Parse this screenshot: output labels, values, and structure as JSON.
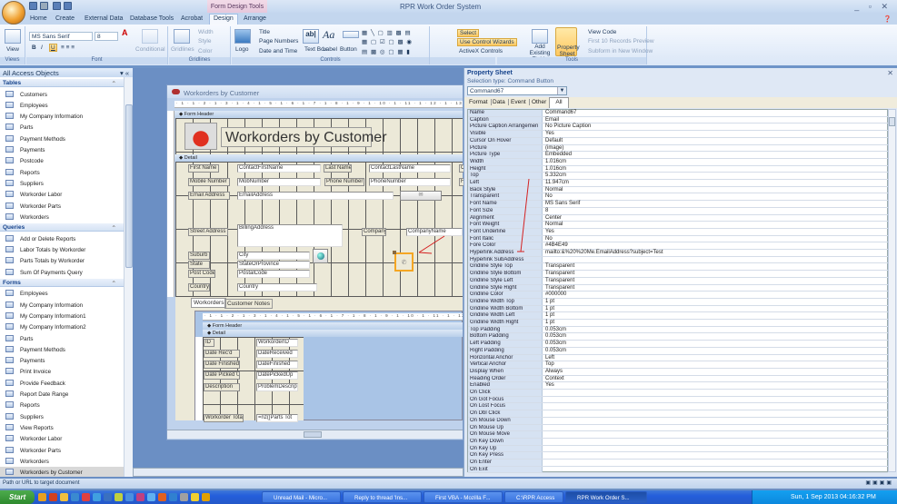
{
  "app_title": "RPR Work Order System",
  "context_title": "Form Design Tools",
  "window_controls": "_ ▫ ✕",
  "ribbon": {
    "tabs": [
      "Home",
      "Create",
      "External Data",
      "Database Tools",
      "Acrobat",
      "Design",
      "Arrange"
    ],
    "active_tab": "Design",
    "font_name": "MS Sans Serif",
    "font_size": "8",
    "buttons": {
      "view": "View",
      "conditional": "Conditional",
      "gridlines": "Gridlines",
      "width": "Width",
      "style": "Style",
      "color": "Color",
      "logo": "Logo",
      "title": "Title",
      "page_numbers": "Page Numbers",
      "date_time": "Date and Time",
      "text_box": "Text Box",
      "label": "Label",
      "button": "Button",
      "select": "Select",
      "use_control_wizards": "Use Control Wizards",
      "activex": "ActiveX Controls",
      "add_existing_fields": "Add Existing Fields",
      "property_sheet": "Property Sheet",
      "view_code": "View Code",
      "first10": "First 10 Records Preview",
      "subform_new": "Subform in New Window"
    },
    "groups": [
      "Views",
      "Font",
      "Gridlines",
      "Controls",
      "Tools"
    ]
  },
  "nav": {
    "header": "All Access Objects",
    "groups": [
      {
        "label": "Tables",
        "items": [
          "Customers",
          "Employees",
          "My Company Information",
          "Parts",
          "Payment Methods",
          "Payments",
          "Postcode",
          "Reports",
          "Suppliers",
          "Workorder Labor",
          "Workorder Parts",
          "Workorders"
        ]
      },
      {
        "label": "Queries",
        "items": [
          "Add or Delete Reports",
          "Labor Totals by Workorder",
          "Parts Totals by Workorder",
          "Sum Of Payments Query"
        ]
      },
      {
        "label": "Forms",
        "items": [
          "Employees",
          "My Company Information",
          "My Company Information1",
          "My Company Information2",
          "Parts",
          "Payment Methods",
          "Payments",
          "Print Invoice",
          "Provide Feedback",
          "Report Date Range",
          "Reports",
          "Suppliers",
          "View Reports",
          "Workorder Labor",
          "Workorder Parts",
          "Workorders",
          "Workorders by Customer",
          "Workorders by Customer Subform"
        ]
      }
    ],
    "selected": "Workorders by Customer"
  },
  "form": {
    "window_title": "Workorders by Customer",
    "ruler": "· 1 · 1 · 2 · 1 · 3 · 1 · 4 · 1 · 5 · 1 · 6 · 1 · 7 · 1 · 8 · 1 · 9 · 1 · 10 · 1 · 11 · 1 · 12 · 1 · 13 · 1 · 14 · 1 · 15 ·",
    "form_header": "Form Header",
    "detail": "Detail",
    "header_title": "Workorders by Customer",
    "labels": {
      "first_name": "First Name",
      "last_name": "Last Name",
      "co": "Cu",
      "mobile": "Mobile Number",
      "phone": "Phone Number",
      "fa": "Fa",
      "email": "Email Address",
      "street": "Street Address",
      "company": "Company",
      "suburb": "Suburb",
      "state": "State",
      "post_code": "Post Code",
      "country": "Country"
    },
    "fields": {
      "first_name": "ContactFirstName",
      "last_name": "ContactLastName",
      "mobile": "MobNumber",
      "phone": "PhoneNumber",
      "email": "EmailAddress",
      "street": "BillingAddress",
      "company": "CompanyName",
      "suburb": "City",
      "state": "StateOrProvince",
      "post_code": "PostalCode",
      "country": "Country"
    },
    "tabs": [
      "Workorders",
      "Customer Notes"
    ],
    "subform": {
      "labels": [
        "ID",
        "Date Rec'd",
        "Date Finished",
        "Date Picked Up",
        "Description",
        "Workorder Total"
      ],
      "fields": [
        "WorkorderID",
        "DateReceived",
        "DateFinished",
        "DatePickedUp",
        "ProblemDescript",
        "=nz([Parts Tot"
      ]
    }
  },
  "property_sheet": {
    "title": "Property Sheet",
    "selection_type": "Selection type:  Command Button",
    "selected_control": "Command67",
    "tabs": [
      "Format",
      "Data",
      "Event",
      "Other",
      "All"
    ],
    "active_tab": "All",
    "rows": [
      [
        "Name",
        "Command67"
      ],
      [
        "Caption",
        "Email"
      ],
      [
        "Picture Caption Arrangemen",
        "No Picture Caption"
      ],
      [
        "Visible",
        "Yes"
      ],
      [
        "Cursor On Hover",
        "Default"
      ],
      [
        "Picture",
        "(image)"
      ],
      [
        "Picture Type",
        "Embedded"
      ],
      [
        "Width",
        "1.016cm"
      ],
      [
        "Height",
        "1.016cm"
      ],
      [
        "Top",
        "5.332cm"
      ],
      [
        "Left",
        "11.947cm"
      ],
      [
        "Back Style",
        "Normal"
      ],
      [
        "Transparent",
        "No"
      ],
      [
        "Font Name",
        "MS Sans Serif"
      ],
      [
        "Font Size",
        "8"
      ],
      [
        "Alignment",
        "Center"
      ],
      [
        "Font Weight",
        "Normal"
      ],
      [
        "Font Underline",
        "Yes"
      ],
      [
        "Font Italic",
        "No"
      ],
      [
        "Fore Color",
        "#4B4E49"
      ],
      [
        "Hyperlink Address",
        "mailto:&%20%20Me.EmailAddress?subject=Test"
      ],
      [
        "Hyperlink SubAddress",
        ""
      ],
      [
        "Gridline Style Top",
        "Transparent"
      ],
      [
        "Gridline Style Bottom",
        "Transparent"
      ],
      [
        "Gridline Style Left",
        "Transparent"
      ],
      [
        "Gridline Style Right",
        "Transparent"
      ],
      [
        "Gridline Color",
        "#000000"
      ],
      [
        "Gridline Width Top",
        "1 pt"
      ],
      [
        "Gridline Width Bottom",
        "1 pt"
      ],
      [
        "Gridline Width Left",
        "1 pt"
      ],
      [
        "Gridline Width Right",
        "1 pt"
      ],
      [
        "Top Padding",
        "0.053cm"
      ],
      [
        "Bottom Padding",
        "0.053cm"
      ],
      [
        "Left Padding",
        "0.053cm"
      ],
      [
        "Right Padding",
        "0.053cm"
      ],
      [
        "Horizontal Anchor",
        "Left"
      ],
      [
        "Vertical Anchor",
        "Top"
      ],
      [
        "Display When",
        "Always"
      ],
      [
        "Reading Order",
        "Context"
      ],
      [
        "Enabled",
        "Yes"
      ],
      [
        "On Click",
        ""
      ],
      [
        "On Got Focus",
        ""
      ],
      [
        "On Lost Focus",
        ""
      ],
      [
        "On Dbl Click",
        ""
      ],
      [
        "On Mouse Down",
        ""
      ],
      [
        "On Mouse Up",
        ""
      ],
      [
        "On Mouse Move",
        ""
      ],
      [
        "On Key Down",
        ""
      ],
      [
        "On Key Up",
        ""
      ],
      [
        "On Key Press",
        ""
      ],
      [
        "On Enter",
        ""
      ],
      [
        "On Exit",
        ""
      ]
    ]
  },
  "status_bar": "Path or URL to target document",
  "taskbar": {
    "start": "Start",
    "tasks": [
      "Unread Mail - Micro...",
      "Reply to thread 'Ins...",
      "First VBA - Mozilla F...",
      "C:\\RPR Access",
      "RPR Work Order S..."
    ],
    "active_task": "RPR Work Order S...",
    "clock": "Sun, 1 Sep 2013  04:16:32 PM"
  },
  "colors": {
    "accent": "#15428b",
    "selection_orange": "#f5a623",
    "arrow_red": "#d42020"
  }
}
